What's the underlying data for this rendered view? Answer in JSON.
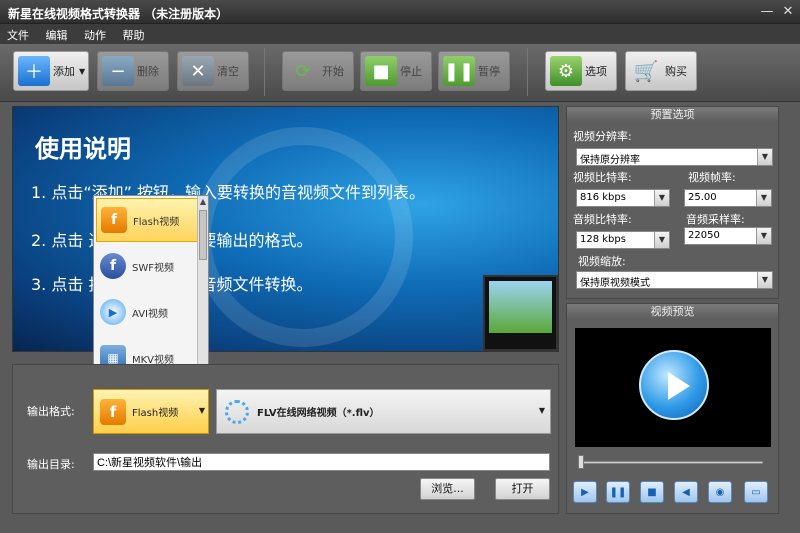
{
  "window": {
    "title": "新星在线视频格式转换器 （未注册版本）",
    "minimize": "—",
    "close": "✕"
  },
  "menu": [
    "文件",
    "编辑",
    "动作",
    "帮助"
  ],
  "toolbar": {
    "add": "添加",
    "delete": "删除",
    "clear": "清空",
    "start": "开始",
    "stop": "停止",
    "pause": "暂停",
    "options": "选项",
    "buy": "购买"
  },
  "banner": {
    "title": "使用说明",
    "step1": "1. 点击“添加”    按钮，输入要转换的音视频文件到列表。",
    "step2": "2. 点击                   选项框，选择您要输出的格式。",
    "step3": "3. 点击                  按钮，开始视频音频文件转换。"
  },
  "format_menu": [
    {
      "label": "Flash视频",
      "glyph": "f",
      "selected": true
    },
    {
      "label": "SWF视频",
      "glyph": "f",
      "selected": false
    },
    {
      "label": "AVI视频",
      "glyph": "▶",
      "selected": false
    },
    {
      "label": "MKV视频",
      "glyph": "▦",
      "selected": false
    }
  ],
  "output": {
    "format_label": "输出格式:",
    "format_value": "Flash视频",
    "format_glyph": "f",
    "subformat_value": "FLV在线网络视频（*.flv）",
    "dir_label": "输出目录:",
    "dir_value": "C:\\新星视频软件\\输出",
    "browse": "浏览...",
    "open": "打开"
  },
  "presets": {
    "header": "预置选项",
    "resolution_label": "视频分辨率:",
    "resolution_value": "保持原分辨率",
    "vbitrate_label": "视频比特率:",
    "vbitrate_value": "816 kbps",
    "fps_label": "视频帧率:",
    "fps_value": "25.00",
    "abitrate_label": "音频比特率:",
    "abitrate_value": "128 kbps",
    "samplerate_label": "音频采样率:",
    "samplerate_value": "22050",
    "scale_label": "视频缩放:",
    "scale_value": "保持原视频模式"
  },
  "preview": {
    "header": "视频预览"
  },
  "colors": {
    "accent_blue": "#2f9ae8",
    "highlight_yellow": "#ffd45a",
    "flash_orange": "#e57a00"
  }
}
